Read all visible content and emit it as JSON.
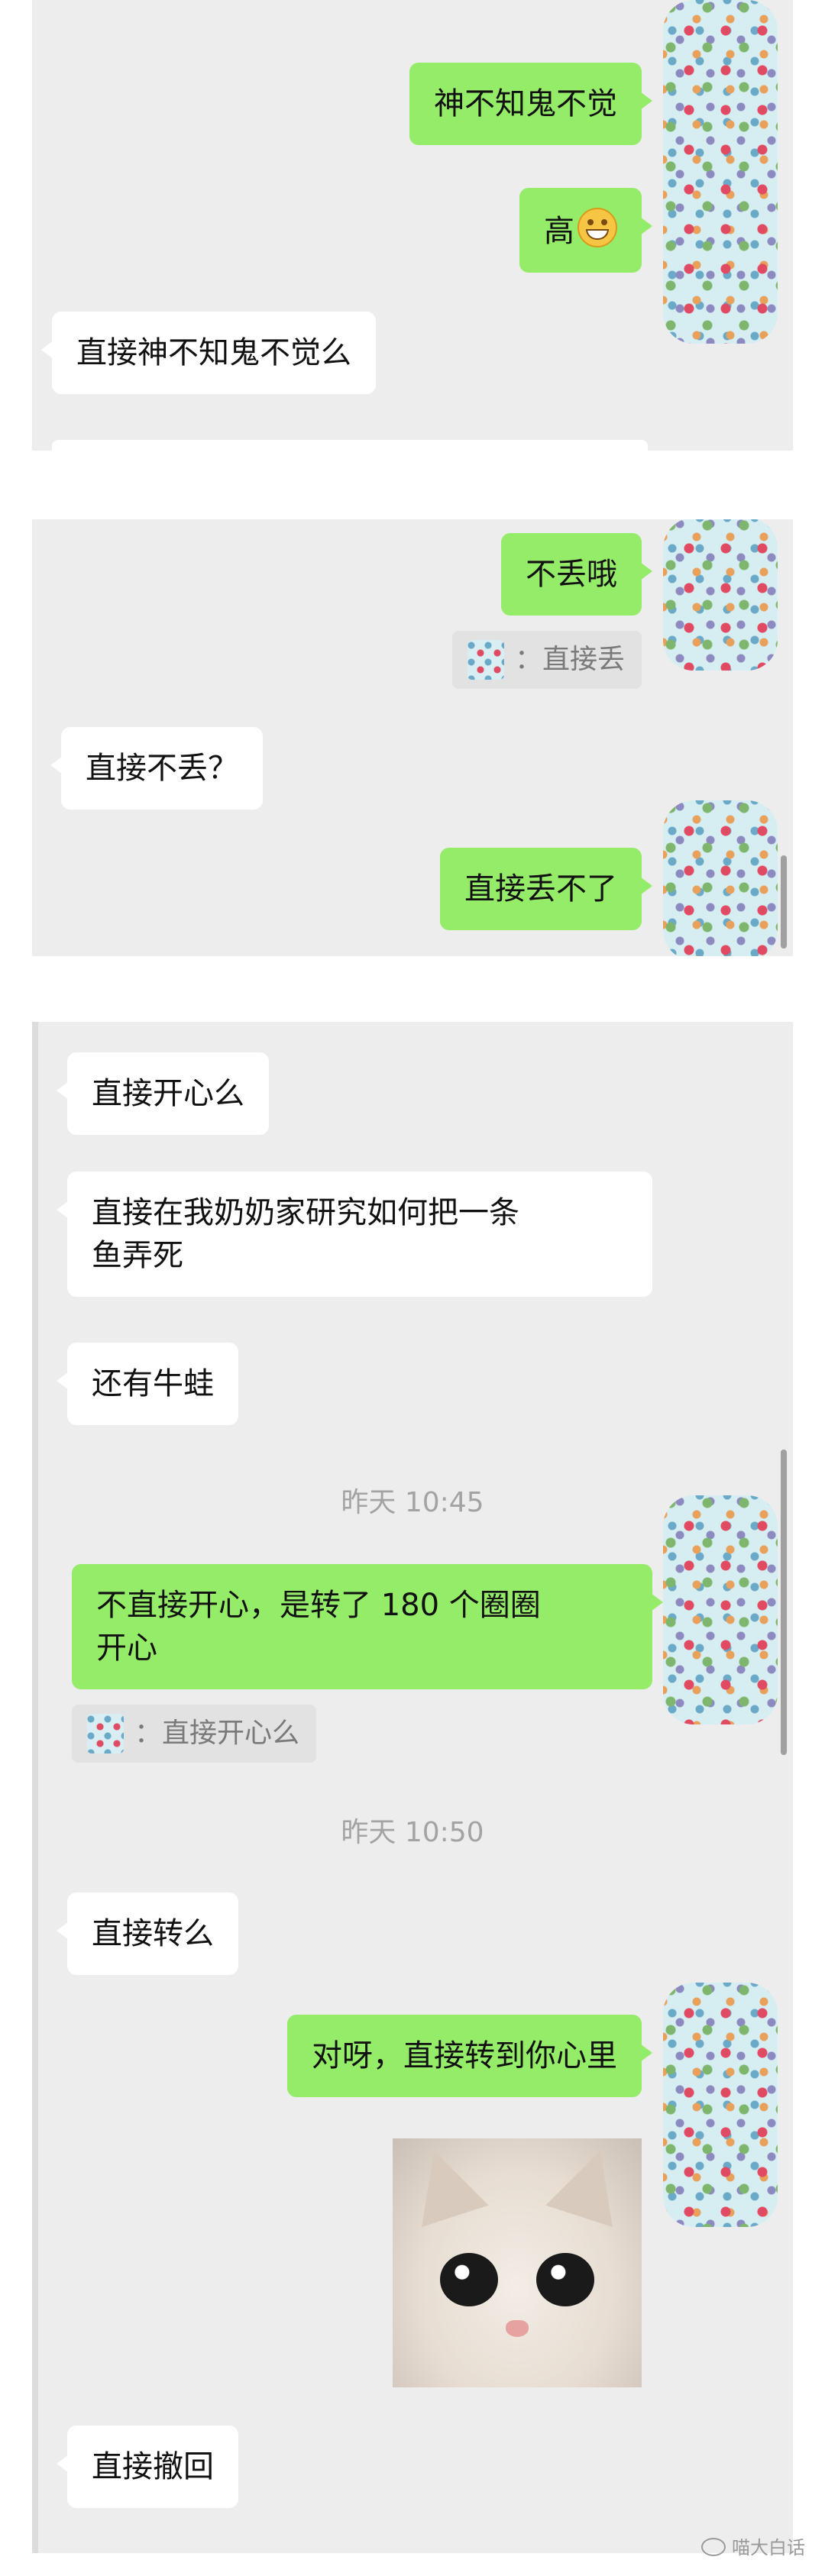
{
  "panel1": {
    "messages": [
      {
        "side": "me",
        "text": "神不知鬼不觉"
      },
      {
        "side": "me",
        "text": "高",
        "emoji": "grin-emoji"
      },
      {
        "side": "them",
        "text": "直接神不知鬼不觉么"
      }
    ]
  },
  "panel2": {
    "messages": [
      {
        "side": "me",
        "text": "不丢哦"
      },
      {
        "side": "quote",
        "text": "：直接丢"
      },
      {
        "side": "them",
        "text": "直接不丢？"
      },
      {
        "side": "me",
        "text": "直接丢不了"
      }
    ]
  },
  "panel3": {
    "msg_happy": "直接开心么",
    "msg_fish_line1": "直接在我奶奶家研究如何把一条",
    "msg_fish_line2": "鱼弄死",
    "msg_frog": "还有牛蛙",
    "time1": "昨天 10:45",
    "msg_spin_line1": "不直接开心，是转了 180 个圈圈",
    "msg_spin_line2": "开心",
    "quote_happy": "：直接开心么",
    "time2": "昨天 10:50",
    "msg_turn": "直接转么",
    "msg_heart": "对呀，直接转到你心里",
    "sticker": "cat-sticker",
    "msg_recall": "直接撤回"
  },
  "watermark": "喵大白话",
  "colors": {
    "my_bubble": "#95ec69",
    "their_bubble": "#ffffff",
    "chat_bg": "#ededed"
  }
}
